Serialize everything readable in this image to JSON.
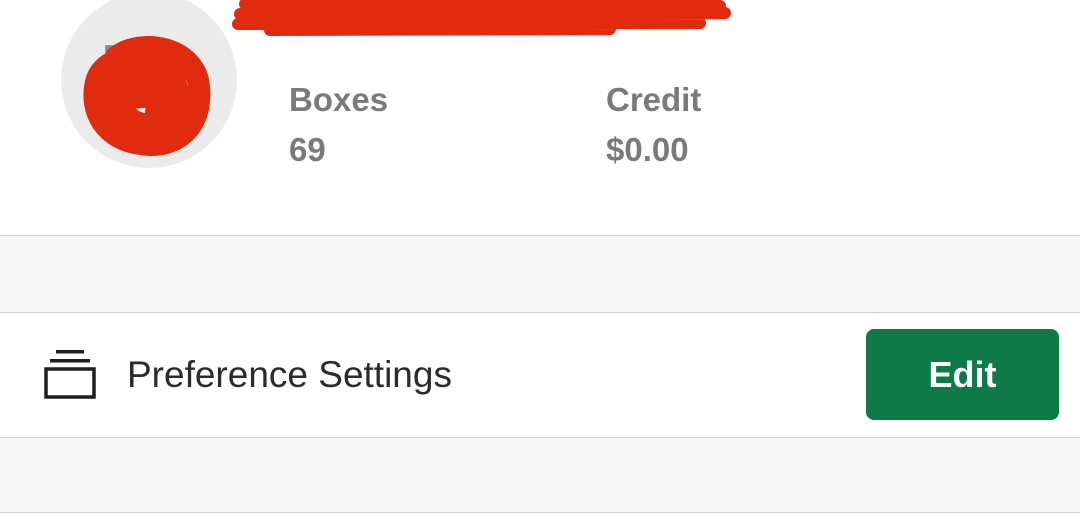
{
  "profile": {
    "avatar_initials": "EA",
    "boxes_label": "Boxes",
    "boxes_value": "69",
    "credit_label": "Credit",
    "credit_value": "$0.00"
  },
  "preferences": {
    "label": "Preference Settings",
    "edit_label": "Edit",
    "icon": "stack-icon"
  },
  "colors": {
    "accent": "#0e7a47",
    "redaction": "#e02b0f",
    "muted_text": "#7a7a7a"
  }
}
